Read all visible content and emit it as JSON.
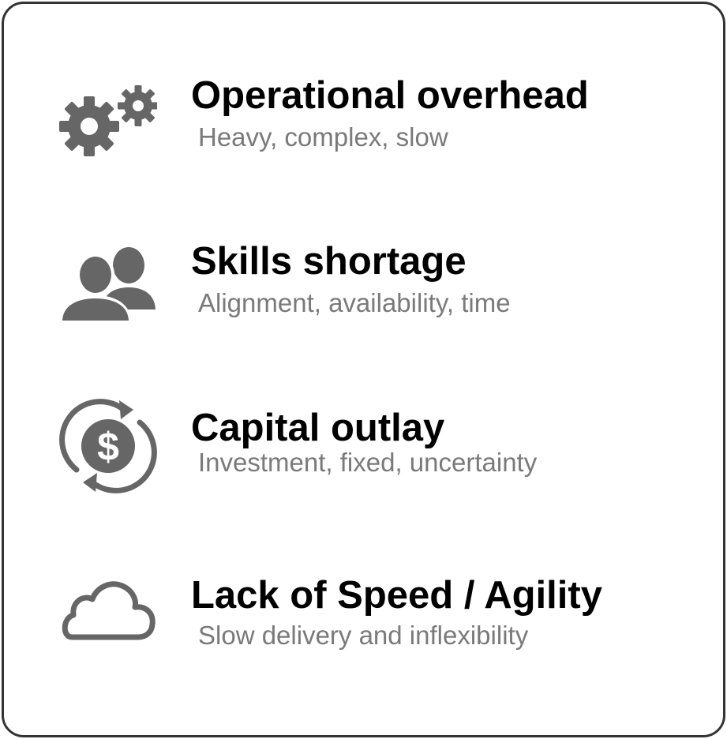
{
  "colors": {
    "icon": "#666666",
    "title": "#000000",
    "subtitle": "#7a7a7a",
    "border": "#333333"
  },
  "items": [
    {
      "icon": "gears-icon",
      "title": "Operational overhead",
      "subtitle": "Heavy, complex, slow"
    },
    {
      "icon": "users-icon",
      "title": "Skills shortage",
      "subtitle": "Alignment, availability, time"
    },
    {
      "icon": "dollar-cycle-icon",
      "title": "Capital outlay",
      "subtitle": "Investment, fixed, uncertainty"
    },
    {
      "icon": "cloud-icon",
      "title": "Lack of Speed / Agility",
      "subtitle": "Slow delivery and inflexibility"
    }
  ]
}
